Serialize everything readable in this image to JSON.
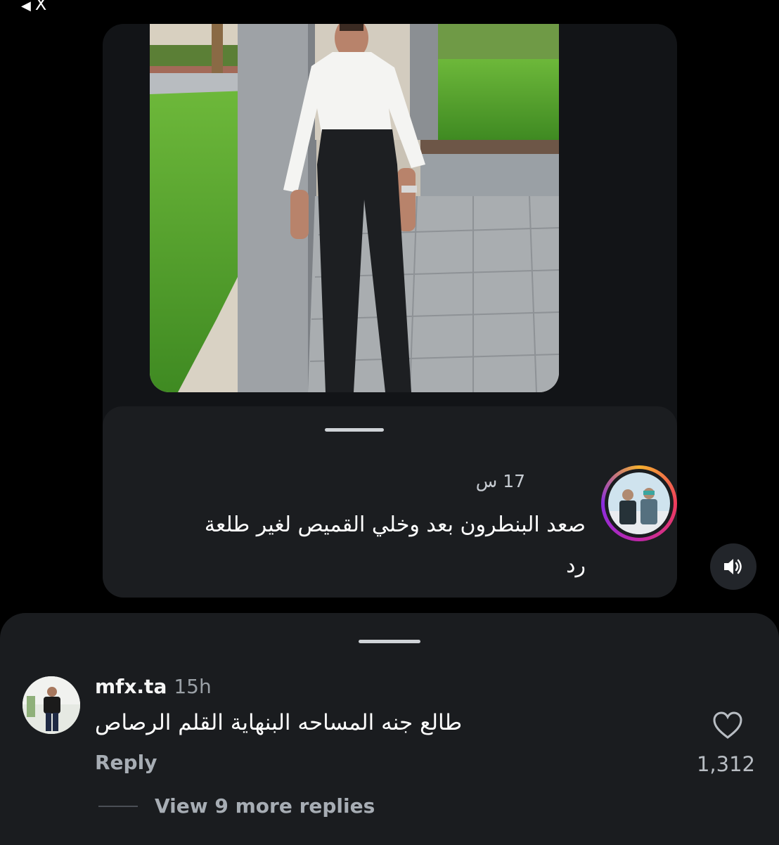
{
  "status_bar": {
    "back_indicator": "◀",
    "app_label": "X"
  },
  "shared_reply": {
    "time": "17 س",
    "text": "صعد البنطرون بعد وخلي القميص لغير طلعة",
    "reply_label": "رد"
  },
  "comment": {
    "username": "mfx.ta",
    "time": "15h",
    "text": "طالع جنه المساحه البنهاية القلم الرصاص",
    "reply_label": "Reply",
    "like_count": "1,312"
  },
  "view_more_label": "View 9 more replies",
  "icons": {
    "sound": "speaker-icon",
    "like": "heart-icon"
  }
}
